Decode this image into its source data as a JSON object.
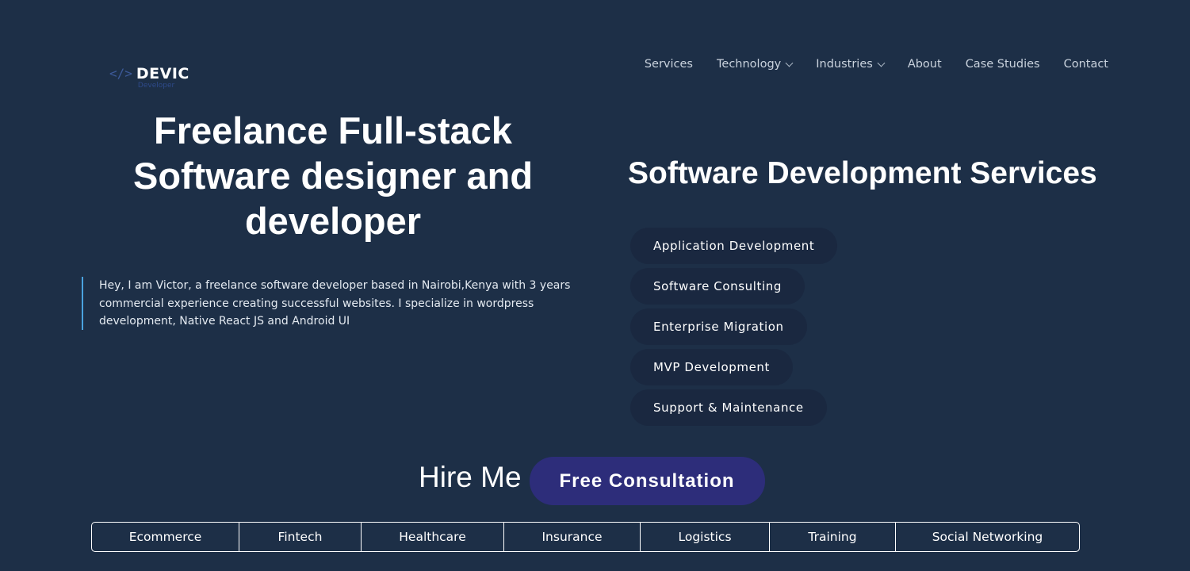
{
  "logo": {
    "icon": "</>",
    "name": "DEVIC",
    "tagline": "Developer"
  },
  "nav": {
    "items": [
      {
        "label": "Services",
        "dropdown": false
      },
      {
        "label": "Technology",
        "dropdown": true
      },
      {
        "label": "Industries",
        "dropdown": true
      },
      {
        "label": "About",
        "dropdown": false
      },
      {
        "label": "Case Studies",
        "dropdown": false
      },
      {
        "label": "Contact",
        "dropdown": false
      }
    ]
  },
  "hero": {
    "title_lines": [
      "Freelance Full-stack",
      "Software designer and",
      "developer"
    ],
    "intro": "Hey, I am Victor, a freelance software developer based in Nairobi,Kenya with 3 years commercial experience creating successful websites. I specialize in wordpress development, Native React JS and Android UI"
  },
  "services": {
    "title": "Software Development Services",
    "items": [
      "Application Development",
      "Software Consulting",
      "Enterprise Migration",
      "MVP Development",
      "Support & Maintenance"
    ]
  },
  "hire": {
    "label": "Hire Me",
    "button": "Free Consultation"
  },
  "industries": [
    "Ecommerce",
    "Fintech",
    "Healthcare",
    "Insurance",
    "Logistics",
    "Training",
    "Social Networking"
  ],
  "colors": {
    "background": "#1d2f47",
    "pill": "#1a2840",
    "cta": "#2d2d7a",
    "accent_border": "#4aa3df"
  }
}
